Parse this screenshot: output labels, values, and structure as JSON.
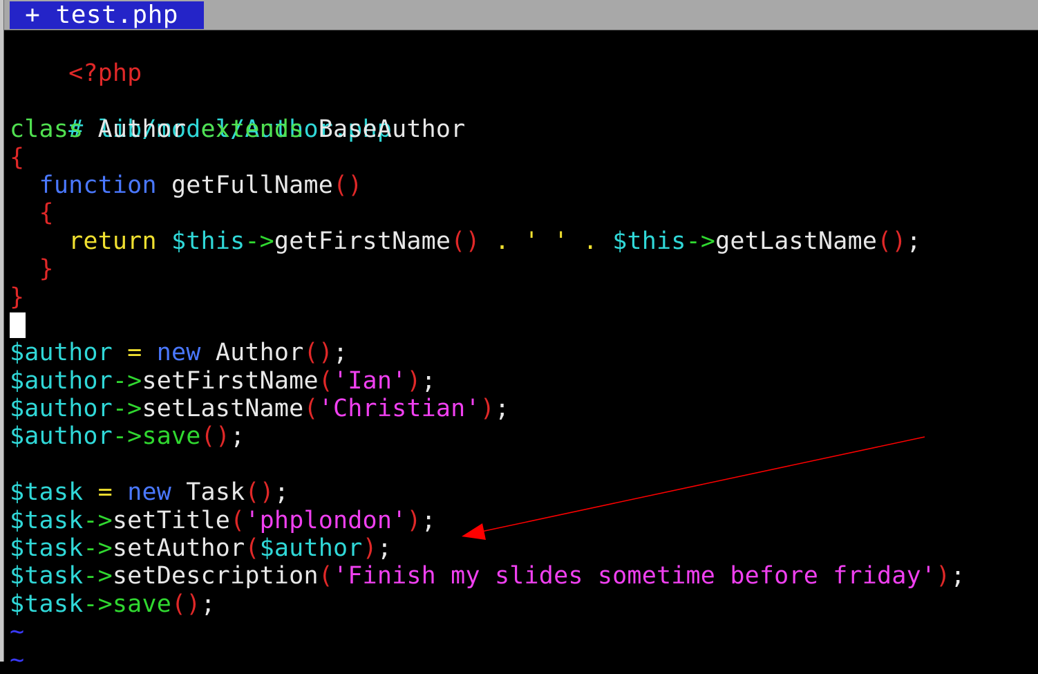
{
  "tab": {
    "label": " + test.php "
  },
  "code": {
    "open_tag": "<?php",
    "comment": "# lib/model/Author.php",
    "class_kw": "class",
    "class_name": " Author ",
    "extends_kw": "extends",
    "base_class": " BaseAuthor",
    "open_brace": "{",
    "close_brace": "}",
    "function_kw": "function",
    "method_name": " getFullName",
    "empty_parens": "()",
    "return_kw": "return",
    "this_var": "$this",
    "arrow": "->",
    "get_first": "getFirstName",
    "concat": " . ",
    "space_str": "' '",
    "get_last": "getLastName",
    "semicolon": ";",
    "author_var": "$author",
    "task_var": "$task",
    "assign": " = ",
    "new_kw": "new",
    "author_class": " Author",
    "task_class": " Task",
    "set_first": "setFirstName",
    "set_last": "setLastName",
    "save": "save",
    "open_paren": "(",
    "close_paren": ")",
    "str_ian": "'Ian'",
    "str_christian": "'Christian'",
    "set_title": "setTitle",
    "str_phplondon": "'phplondon'",
    "set_author": "setAuthor",
    "set_description": "setDescription",
    "str_description": "'Finish my slides sometime before friday'",
    "tilde": "~"
  },
  "colors": {
    "tab_bg": "#2424c8",
    "keyword": "#50e050",
    "function_kw": "#4a78ff",
    "return_kw": "#f0e030",
    "variable": "#30d8d8",
    "arrow": "#30d830",
    "string": "#f040f0",
    "paren": "#e02828",
    "annotation_arrow": "#ff0000"
  }
}
